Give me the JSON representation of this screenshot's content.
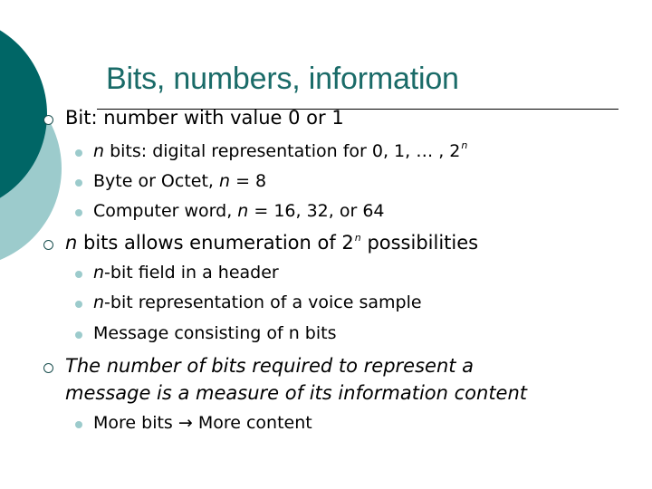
{
  "slide": {
    "title": "Bits, numbers, information",
    "bullets": [
      {
        "text": "Bit:  number with value 0 or 1",
        "children": [
          {
            "italic_prefix": "n",
            "text": " bits:  digital representation for 0, 1, … , 2",
            "sup": "n"
          },
          {
            "text": "Byte or Octet, ",
            "italic": "n",
            "suffix": " = 8"
          },
          {
            "text": "Computer word, ",
            "italic": "n",
            "suffix": " = 16, 32, or 64"
          }
        ]
      },
      {
        "italic_prefix": "n",
        "text": " bits allows enumeration of 2",
        "sup": "n",
        "suffix": " possibilities",
        "children": [
          {
            "italic_prefix": "n",
            "text": "-bit field in a header"
          },
          {
            "italic_prefix": "n",
            "text": "-bit representation of a voice sample"
          },
          {
            "text": "Message consisting of n bits"
          }
        ]
      },
      {
        "line1": "The number of bits required to represent a",
        "line2": "message is a measure of its information content",
        "children": [
          {
            "text": "More bits → More content"
          }
        ]
      }
    ]
  },
  "colors": {
    "title": "#1a6b68",
    "dark_circle": "#006666",
    "light_circle": "#9ccbcc"
  }
}
